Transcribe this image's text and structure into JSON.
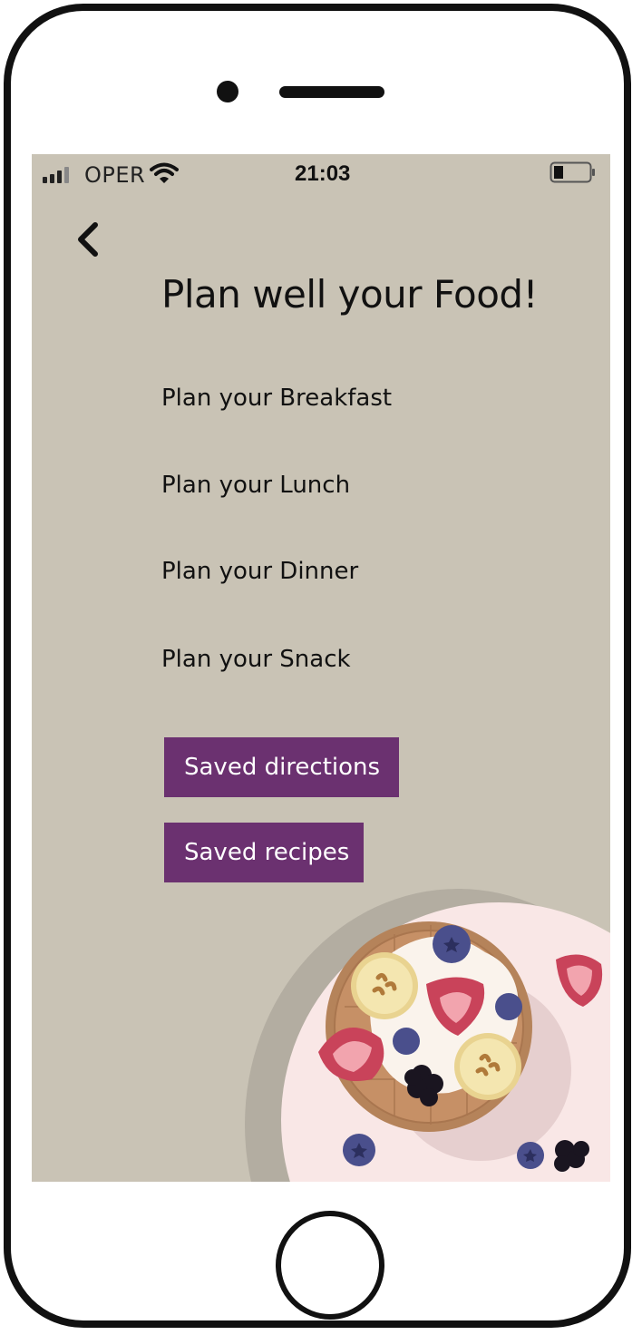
{
  "status_bar": {
    "carrier": "OPER",
    "time": "21:03"
  },
  "header": {
    "back_icon": "chevron-left-icon",
    "title": "Plan well your Food!"
  },
  "menu": {
    "items": [
      {
        "label": "Plan your Breakfast"
      },
      {
        "label": "Plan your Lunch"
      },
      {
        "label": "Plan your Dinner"
      },
      {
        "label": "Plan your Snack"
      }
    ]
  },
  "buttons": {
    "saved_directions": "Saved directions",
    "saved_recipes": "Saved recipes"
  },
  "colors": {
    "screen_background": "#c9c3b5",
    "button_background": "#6b3170",
    "button_text": "#ffffff",
    "plate": "#f9e7e6"
  },
  "illustration": {
    "subject": "waffle with bananas, strawberries, blueberries and blackberries on a plate"
  }
}
